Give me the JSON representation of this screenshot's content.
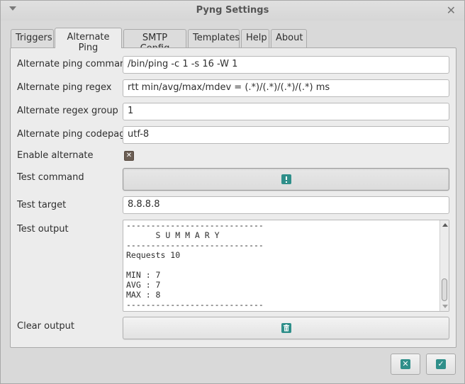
{
  "window": {
    "title": "Pyng Settings",
    "close_glyph": "✕"
  },
  "tabs": [
    {
      "label": "Triggers",
      "active": false
    },
    {
      "label": "Alternate Ping",
      "active": true
    },
    {
      "label": "SMTP Config",
      "active": false
    },
    {
      "label": "Templates",
      "active": false
    },
    {
      "label": "Help",
      "active": false
    },
    {
      "label": "About",
      "active": false
    }
  ],
  "form": {
    "ping_command": {
      "label": "Alternate ping command",
      "value": "/bin/ping -c 1 -s 16 -W 1"
    },
    "ping_regex": {
      "label": "Alternate ping regex",
      "value": "rtt min/avg/max/mdev = (.*)/(.*)/(.*)/(.*) ms"
    },
    "regex_group": {
      "label": "Alternate regex group",
      "value": "1"
    },
    "codepage": {
      "label": "Alternate ping codepage",
      "value": "utf-8"
    },
    "enable_alternate": {
      "label": "Enable alternate",
      "checked": true
    },
    "test_command": {
      "label": "Test command",
      "icon": "exclamation-icon"
    },
    "test_target": {
      "label": "Test target",
      "value": "8.8.8.8"
    },
    "test_output": {
      "label": "Test output",
      "text": "----------------------------\n      S U M M A R Y\n----------------------------\nRequests 10\n\nMIN : 7\nAVG : 7\nMAX : 8\n----------------------------"
    },
    "clear_output": {
      "label": "Clear output",
      "icon": "trash-icon"
    }
  },
  "footer": {
    "cancel_icon": "cancel-icon",
    "ok_icon": "ok-icon"
  },
  "colors": {
    "accent": "#2f8f8a",
    "checkbox": "#6b5e54"
  }
}
